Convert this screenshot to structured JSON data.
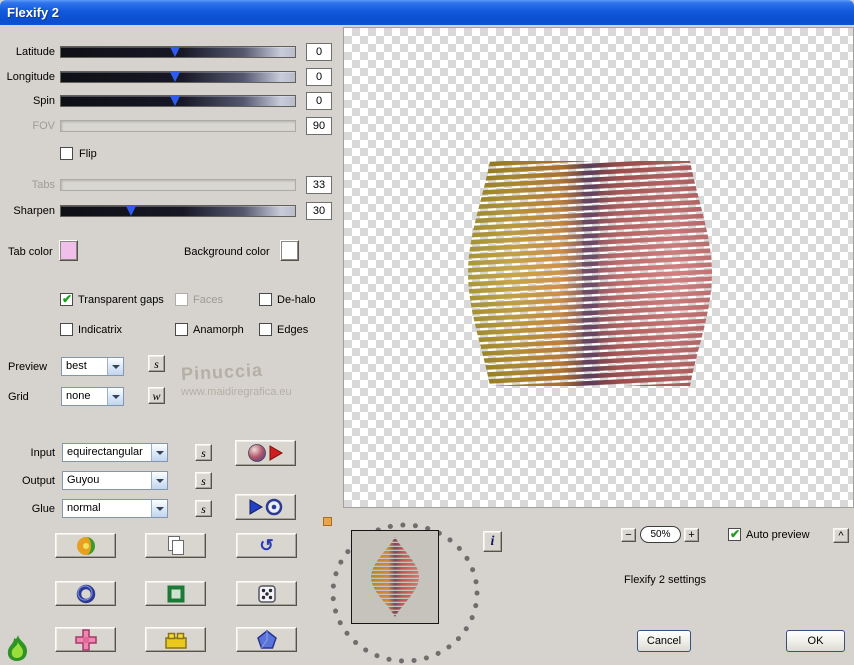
{
  "window": {
    "title": "Flexify 2"
  },
  "sliders": {
    "latitude": {
      "label": "Latitude",
      "value": "0"
    },
    "longitude": {
      "label": "Longitude",
      "value": "0"
    },
    "spin": {
      "label": "Spin",
      "value": "0"
    },
    "fov": {
      "label": "FOV",
      "value": "90",
      "disabled": true
    },
    "tabs": {
      "label": "Tabs",
      "value": "33",
      "disabled": true
    },
    "sharpen": {
      "label": "Sharpen",
      "value": "30"
    }
  },
  "flip": {
    "label": "Flip",
    "checked": false
  },
  "colors": {
    "tab_color": {
      "label": "Tab color",
      "value": "#f0c0ea"
    },
    "background_color": {
      "label": "Background color",
      "value": "#ffffff"
    }
  },
  "options": {
    "transparent_gaps": {
      "label": "Transparent gaps",
      "checked": true
    },
    "faces": {
      "label": "Faces",
      "checked": false,
      "disabled": true
    },
    "dehalo": {
      "label": "De-halo",
      "checked": false
    },
    "indicatrix": {
      "label": "Indicatrix",
      "checked": false
    },
    "anamorph": {
      "label": "Anamorph",
      "checked": false
    },
    "edges": {
      "label": "Edges",
      "checked": false
    }
  },
  "render": {
    "preview": {
      "label": "Preview",
      "value": "best"
    },
    "grid": {
      "label": "Grid",
      "value": "none"
    }
  },
  "watermark": {
    "line1": "Pinuccia",
    "line2": "www.maidiregrafica.eu"
  },
  "io": {
    "input": {
      "label": "Input",
      "value": "equirectangular"
    },
    "output": {
      "label": "Output",
      "value": "Guyou"
    },
    "glue": {
      "label": "Glue",
      "value": "normal"
    }
  },
  "icons": {
    "script_s": "s",
    "script_w": "w",
    "undo_glyph": "↺",
    "info_glyph": "i",
    "caret_glyph": "^",
    "minus_glyph": "−",
    "plus_glyph": "+"
  },
  "zoom": {
    "value": "50%"
  },
  "auto_preview": {
    "label": "Auto preview",
    "checked": true
  },
  "settings_caption": "Flexify 2 settings",
  "actions": {
    "cancel": "Cancel",
    "ok": "OK"
  }
}
